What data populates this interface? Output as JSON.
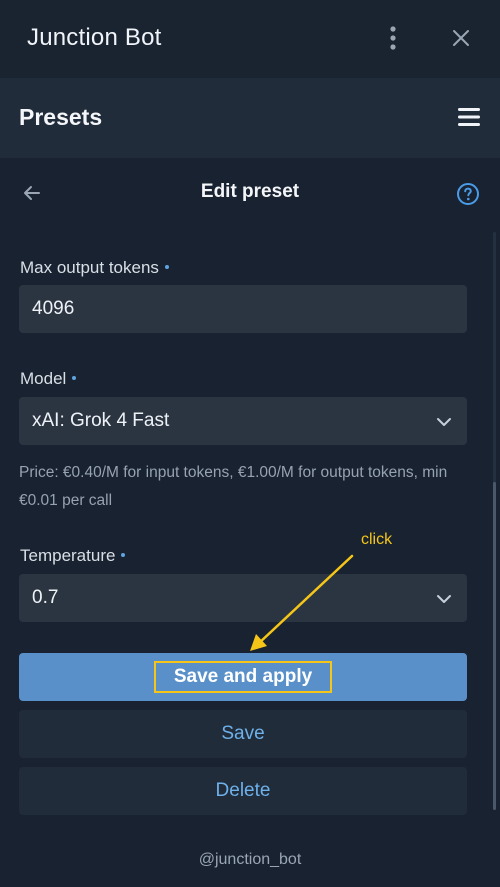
{
  "window": {
    "title": "Junction Bot",
    "menu_icon": "kebab-icon",
    "close_icon": "close-icon"
  },
  "header": {
    "title": "Presets",
    "menu_icon": "hamburger-icon"
  },
  "edit": {
    "back_icon": "arrow-left-icon",
    "title": "Edit preset",
    "help_icon": "question-circle-icon"
  },
  "fields": {
    "max_tokens": {
      "label": "Max output tokens",
      "value": "4096"
    },
    "model": {
      "label": "Model",
      "value": "xAI: Grok 4 Fast"
    },
    "price_note": "Price: €0.40/M for input tokens, €1.00/M for output tokens, min €0.01 per call",
    "temperature": {
      "label": "Temperature",
      "value": "0.7"
    }
  },
  "buttons": {
    "save_and_apply": "Save and apply",
    "save": "Save",
    "delete": "Delete"
  },
  "annotation": {
    "text": "click",
    "color": "#f5c518"
  },
  "footer": {
    "handle": "@junction_bot"
  },
  "colors": {
    "background": "#182230",
    "panel": "#212c3a",
    "field": "#2b3542",
    "accent": "#5a90c9",
    "link": "#6eb0ea"
  }
}
